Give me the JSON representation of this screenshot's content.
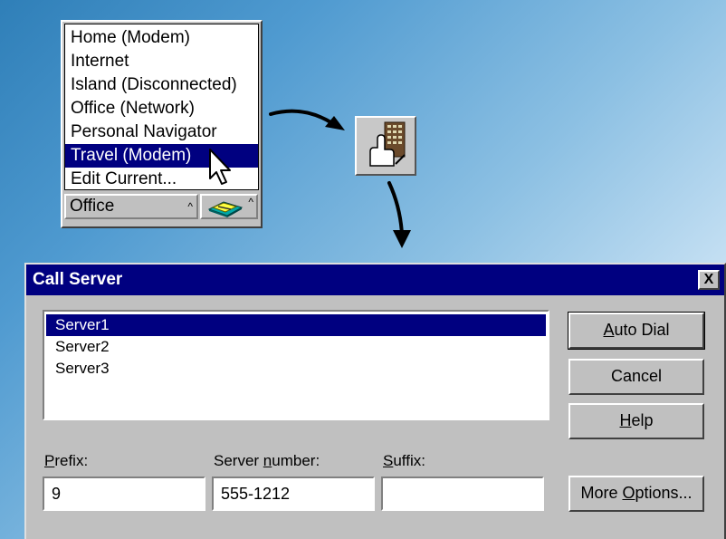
{
  "location_menu": {
    "items": [
      {
        "label": "Home (Modem)"
      },
      {
        "label": "Internet"
      },
      {
        "label": "Island (Disconnected)"
      },
      {
        "label": "Office (Network)"
      },
      {
        "label": "Personal Navigator"
      },
      {
        "label": "Travel (Modem)",
        "selected": true
      },
      {
        "label": "Edit Current..."
      }
    ],
    "current_location": "Office",
    "dropdown_caret": "^",
    "phone_icon": "phone-modem-icon"
  },
  "dialer_button": {
    "icon": "keypad-dial-icon"
  },
  "dialog": {
    "title": "Call Server",
    "close_label": "X",
    "servers": [
      {
        "label": "Server1",
        "selected": true
      },
      {
        "label": "Server2"
      },
      {
        "label": "Server3"
      }
    ],
    "buttons": {
      "auto_dial": {
        "pre": "",
        "mnemonic": "A",
        "post": "uto Dial"
      },
      "cancel": "Cancel",
      "help": {
        "pre": "",
        "mnemonic": "H",
        "post": "elp"
      },
      "more_options": {
        "pre": "More ",
        "mnemonic": "O",
        "post": "ptions..."
      }
    },
    "fields": {
      "prefix": {
        "label_pre": "",
        "mnemonic": "P",
        "label_post": "refix:",
        "value": "9"
      },
      "server_number": {
        "label_pre": "Server ",
        "mnemonic": "n",
        "label_post": "umber:",
        "value": "555-1212"
      },
      "suffix": {
        "label_pre": "",
        "mnemonic": "S",
        "label_post": "uffix:",
        "value": ""
      }
    }
  },
  "colors": {
    "titlebar": "#000080",
    "selection": "#000080",
    "dialog_face": "#c0c0c0"
  }
}
